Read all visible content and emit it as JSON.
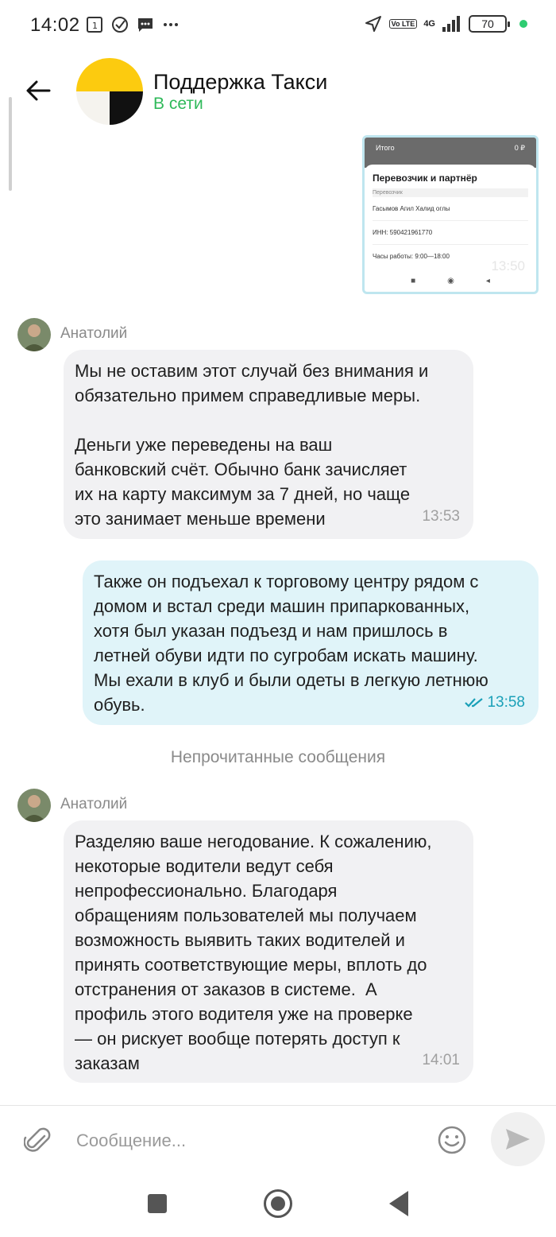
{
  "status_bar": {
    "time": "14:02",
    "battery": "70",
    "network": "4G",
    "lte": "Vo LTE",
    "icons": [
      "sim-notification-icon",
      "check-circle-icon",
      "message-icon",
      "more-icon",
      "location-arrow-icon",
      "signal-icon",
      "battery-icon"
    ]
  },
  "header": {
    "title": "Поддержка Такси",
    "status": "В сети"
  },
  "attachment": {
    "top_left": "Итого",
    "top_right": "0 ₽",
    "heading": "Перевозчик и партнёр",
    "caption": "Перевозчик",
    "rows": [
      "Гасымов Агил Халид оглы",
      "ИНН: 590421961770",
      "Часы работы: 9:00—18:00"
    ],
    "time": "13:50"
  },
  "messages": [
    {
      "sender": "Анатолий",
      "direction": "in",
      "text": "Мы не оставим этот случай без внимания и\nобязательно примем справедливые меры.\n\nДеньги уже переведены на ваш\nбанковский счёт. Обычно банк зачисляет\nих на карту максимум за 7 дней, но чаще\nэто занимает меньше времени",
      "time": "13:53"
    },
    {
      "sender": "",
      "direction": "out",
      "text": "Также он подъехал к торговому центру рядом с\nдомом и встал среди машин припаркованных,\nхотя был указан подъезд и нам пришлось в\nлетней обуви идти по сугробам искать машину.\nМы ехали в клуб и были одеты в легкую летнюю\nобувь.",
      "time": "13:58"
    },
    {
      "sender": "Анатолий",
      "direction": "in",
      "text": "Разделяю ваше негодование. К сожалению,\nнекоторые водители ведут себя\nнепрофессионально. Благодаря\nобращениям пользователей мы получаем\nвозможность выявить таких водителей и\nпринять соответствующие меры, вплоть до\nотстранения от заказов в системе.  А\nпрофиль этого водителя уже на проверке\n— он рискует вообще потерять доступ к\nзаказам",
      "time": "14:01"
    }
  ],
  "unread_divider": "Непрочитанные сообщения",
  "composer": {
    "placeholder": "Сообщение..."
  },
  "colors": {
    "online": "#2fb95a",
    "incoming_bubble": "#f1f1f3",
    "outgoing_bubble": "#e0f4f9",
    "read_ticks": "#1aa0b8"
  }
}
